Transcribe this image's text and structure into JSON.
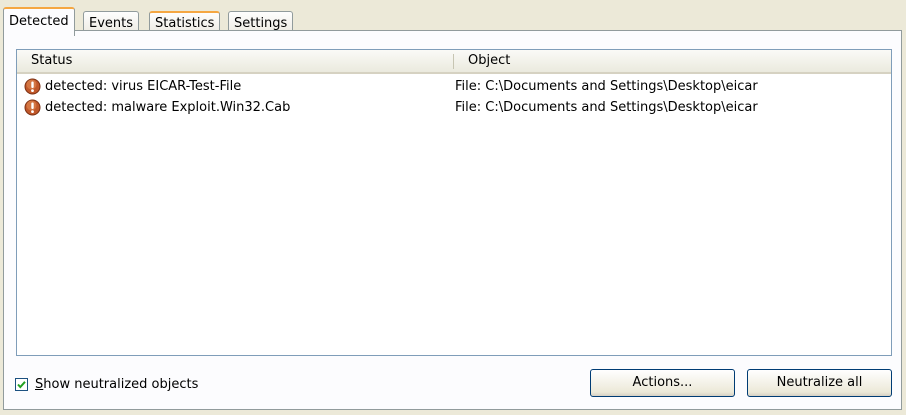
{
  "tabs": [
    {
      "label": "Detected"
    },
    {
      "label": "Events"
    },
    {
      "label": "Statistics"
    },
    {
      "label": "Settings"
    }
  ],
  "list": {
    "columns": [
      "Status",
      "Object"
    ],
    "rows": [
      {
        "icon": "warning-icon",
        "status": "detected: virus EICAR-Test-File",
        "object": "File: C:\\Documents and Settings\\Desktop\\eicar"
      },
      {
        "icon": "warning-icon",
        "status": "detected: malware Exploit.Win32.Cab",
        "object": "File: C:\\Documents and Settings\\Desktop\\eicar"
      }
    ]
  },
  "options": {
    "show_neutralized": {
      "label_accel": "S",
      "label_rest": "how neutralized objects",
      "checked": true
    }
  },
  "buttons": {
    "actions": "Actions...",
    "neutralize_all": "Neutralize all"
  },
  "colors": {
    "accent_tab": "#f5a742",
    "warning_icon": "#c0582a",
    "button_border": "#003c74"
  }
}
